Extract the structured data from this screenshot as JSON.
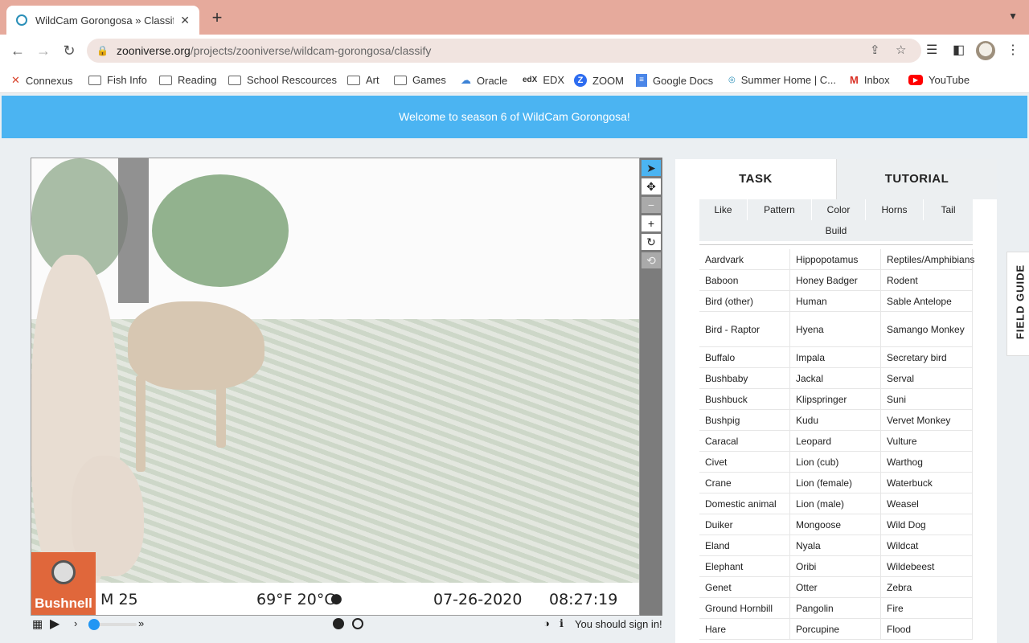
{
  "browser": {
    "tab_title": "WildCam Gorongosa » Classify",
    "url_host": "zooniverse.org",
    "url_path": "/projects/zooniverse/wildcam-gorongosa/classify",
    "bookmarks": [
      "Connexus",
      "Fish Info",
      "Reading",
      "School Rescources",
      "Art",
      "Games",
      "Oracle",
      "EDX",
      "ZOOM",
      "Google Docs",
      "Summer Home | C...",
      "Inbox",
      "YouTube"
    ]
  },
  "banner": {
    "text": "Welcome to season 6 of WildCam Gorongosa!"
  },
  "camera": {
    "brand": "Bushnell",
    "moon": "M",
    "moon_num": "25",
    "temp": "69°F 20°C",
    "date": "07-26-2020",
    "time": "08:27:19"
  },
  "controls": {
    "signin": "You should sign in!"
  },
  "panel": {
    "tab_task": "TASK",
    "tab_tutorial": "TUTORIAL",
    "filters": [
      "Like",
      "Pattern",
      "Color",
      "Horns",
      "Tail",
      "Build"
    ],
    "species": [
      [
        "Aardvark",
        "Hippopotamus",
        "Reptiles/Amphibians"
      ],
      [
        "Baboon",
        "Honey Badger",
        "Rodent"
      ],
      [
        "Bird (other)",
        "Human",
        "Sable Antelope"
      ],
      [
        "Bird - Raptor",
        "Hyena",
        "Samango Monkey"
      ],
      [
        "Buffalo",
        "Impala",
        "Secretary bird"
      ],
      [
        "Bushbaby",
        "Jackal",
        "Serval"
      ],
      [
        "Bushbuck",
        "Klipspringer",
        "Suni"
      ],
      [
        "Bushpig",
        "Kudu",
        "Vervet Monkey"
      ],
      [
        "Caracal",
        "Leopard",
        "Vulture"
      ],
      [
        "Civet",
        "Lion (cub)",
        "Warthog"
      ],
      [
        "Crane",
        "Lion (female)",
        "Waterbuck"
      ],
      [
        "Domestic animal",
        "Lion (male)",
        "Weasel"
      ],
      [
        "Duiker",
        "Mongoose",
        "Wild Dog"
      ],
      [
        "Eland",
        "Nyala",
        "Wildcat"
      ],
      [
        "Elephant",
        "Oribi",
        "Wildebeest"
      ],
      [
        "Genet",
        "Otter",
        "Zebra"
      ],
      [
        "Ground Hornbill",
        "Pangolin",
        "Fire"
      ],
      [
        "Hare",
        "Porcupine",
        "Flood"
      ]
    ],
    "field_guide": "FIELD GUIDE"
  }
}
